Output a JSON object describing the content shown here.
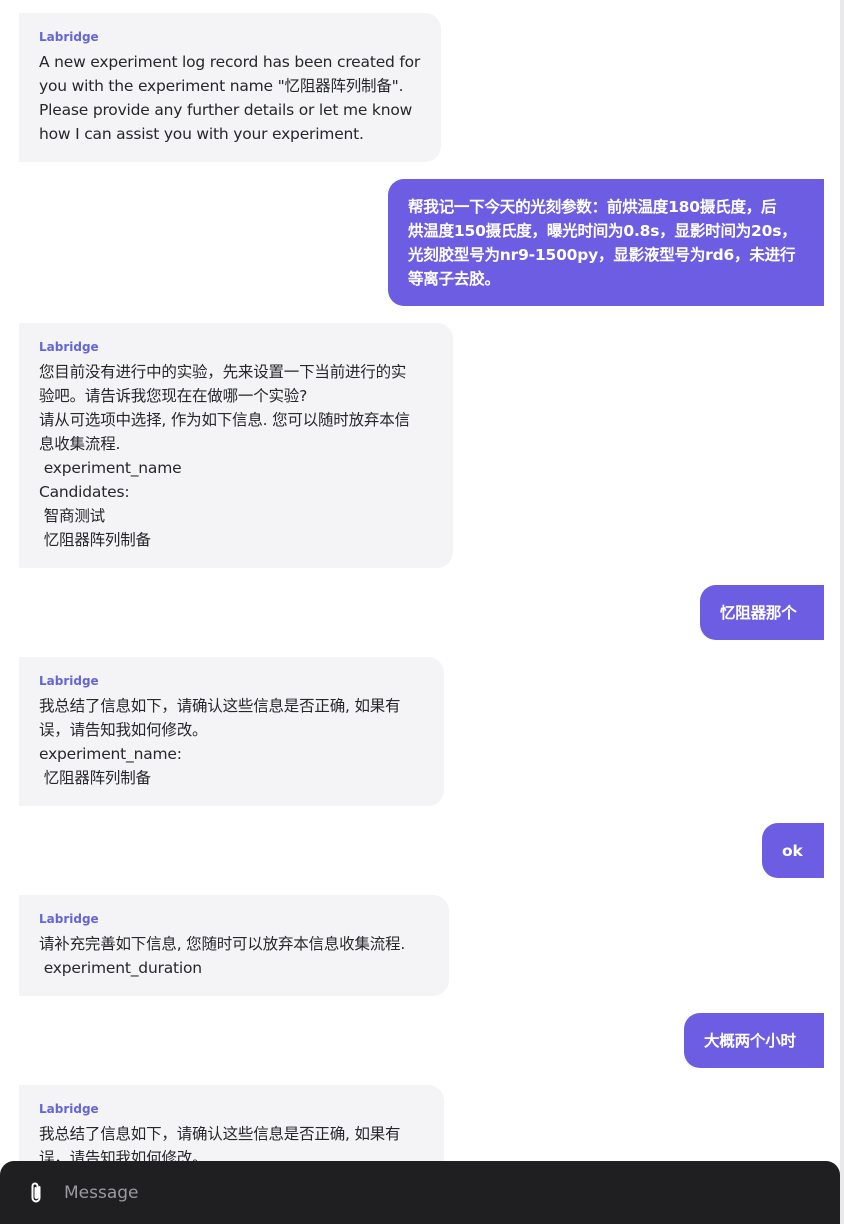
{
  "chat": {
    "messages": [
      {
        "role": "bot",
        "sender": "Labridge",
        "text": "A new experiment log record has been created for\nyou with the experiment name \"忆阻器阵列制备\".\nPlease provide any further details or let me know\nhow I can assist you with your experiment."
      },
      {
        "role": "user",
        "text": "帮我记一下今天的光刻参数：前烘温度180摄氏度，后\n烘温度150摄氏度，曝光时间为0.8s，显影时间为20s，\n光刻胶型号为nr9-1500py，显影液型号为rd6，未进行\n等离子去胶。"
      },
      {
        "role": "bot",
        "sender": "Labridge",
        "text": "您目前没有进行中的实验，先来设置一下当前进行的实\n验吧。请告诉我您现在在做哪一个实验?\n请从可选项中选择, 作为如下信息. 您可以随时放弃本信\n息收集流程.\n experiment_name\nCandidates:\n 智商测试\n 忆阻器阵列制备"
      },
      {
        "role": "user",
        "text": "忆阻器那个"
      },
      {
        "role": "bot",
        "sender": "Labridge",
        "text": "我总结了信息如下，请确认这些信息是否正确, 如果有\n误，请告知我如何修改。\nexperiment_name:\n 忆阻器阵列制备"
      },
      {
        "role": "user",
        "text": "ok"
      },
      {
        "role": "bot",
        "sender": "Labridge",
        "text": "请补充完善如下信息, 您随时可以放弃本信息收集流程.\n experiment_duration"
      },
      {
        "role": "user",
        "text": "大概两个小时"
      },
      {
        "role": "bot",
        "sender": "Labridge",
        "text": "我总结了信息如下，请确认这些信息是否正确, 如果有\n误，请告知我如何修改。"
      }
    ]
  },
  "composer": {
    "placeholder": "Message",
    "attach_icon": "paperclip-icon"
  },
  "colors": {
    "user_bubble": "#6c5de2",
    "bot_bubble": "#f4f4f6",
    "sender_name": "#6466d6",
    "composer_bg": "#1f1f21"
  }
}
